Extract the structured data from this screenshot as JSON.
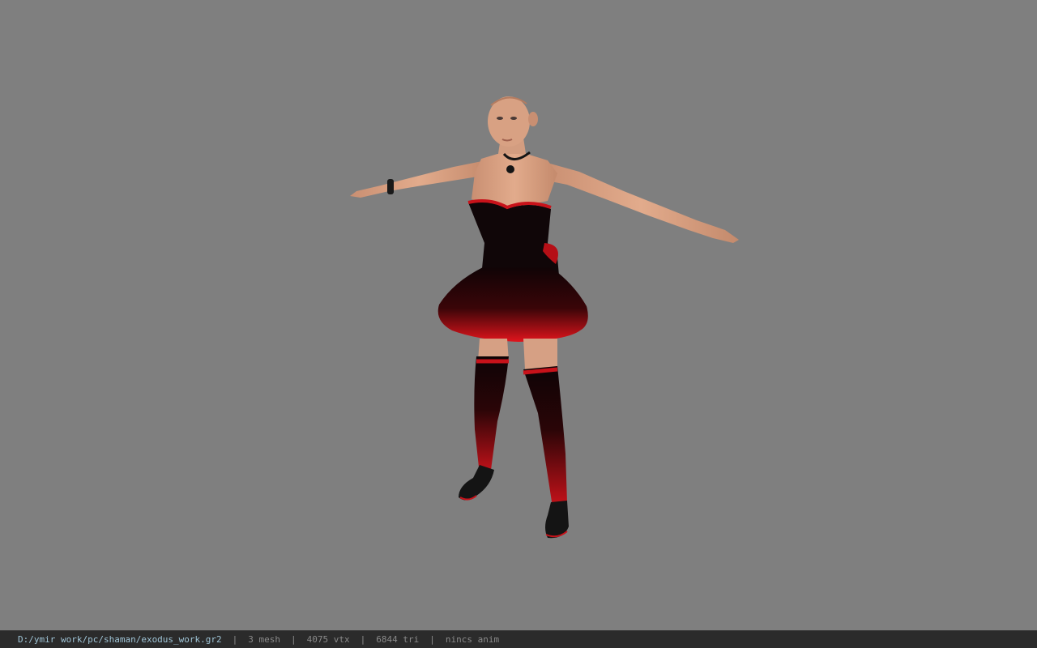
{
  "status_bar": {
    "file_path": "D:/ymir work/pc/shaman/exodus_work.gr2",
    "mesh_count": "3 mesh",
    "vertex_count": "4075 vtx",
    "triangle_count": "6844 tri",
    "animation": "nincs anim",
    "separator": "|"
  },
  "viewport": {
    "background_color": "#7f7f7f"
  },
  "colors": {
    "skin": "#d9a486",
    "dress_dark": "#120608",
    "dress_red": "#d4121a"
  }
}
